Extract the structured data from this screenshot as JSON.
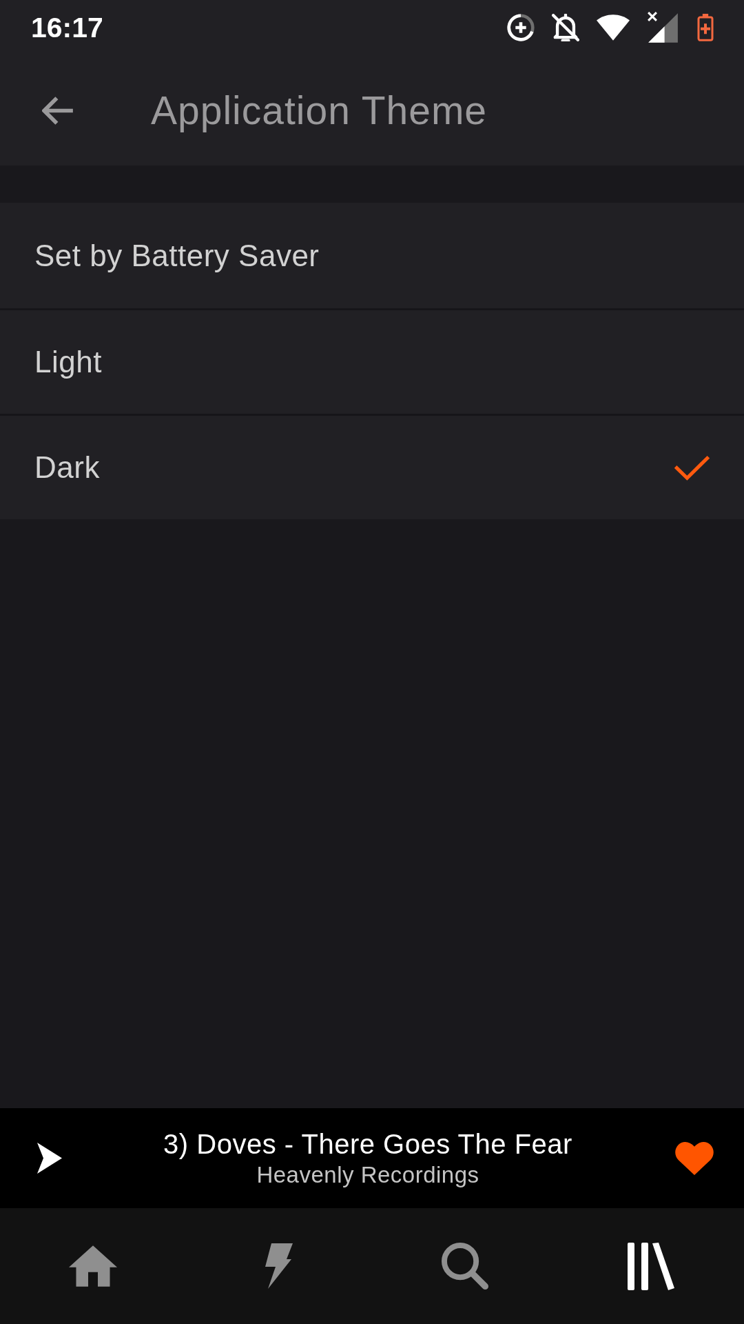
{
  "status_bar": {
    "time": "16:17"
  },
  "app_bar": {
    "title": "Application Theme"
  },
  "options": [
    {
      "label": "Set by Battery Saver",
      "selected": false
    },
    {
      "label": "Light",
      "selected": false
    },
    {
      "label": "Dark",
      "selected": true
    }
  ],
  "now_playing": {
    "title": "3) Doves - There Goes The Fear",
    "subtitle": "Heavenly Recordings",
    "liked": true
  },
  "bottom_nav": [
    {
      "kind": "home",
      "selected": false
    },
    {
      "kind": "lightning",
      "selected": false
    },
    {
      "kind": "search",
      "selected": false
    },
    {
      "kind": "library",
      "selected": true
    }
  ]
}
